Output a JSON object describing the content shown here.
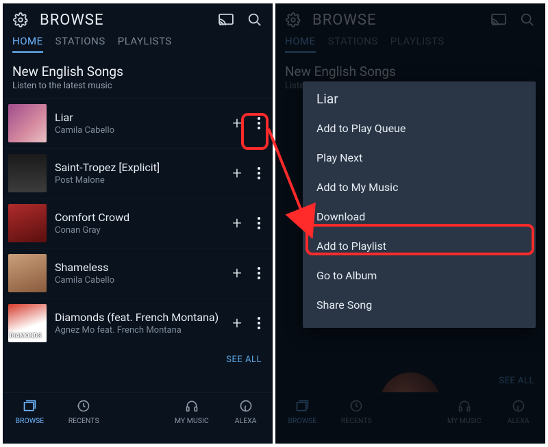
{
  "header": {
    "title": "BROWSE"
  },
  "tabs": [
    "HOME",
    "STATIONS",
    "PLAYLISTS"
  ],
  "active_tab_index": 0,
  "section": {
    "title": "New English Songs",
    "subtitle": "Listen to the latest music"
  },
  "songs": [
    {
      "title": "Liar",
      "artist": "Camila Cabello"
    },
    {
      "title": "Saint-Tropez [Explicit]",
      "artist": "Post Malone"
    },
    {
      "title": "Comfort Crowd",
      "artist": "Conan Gray"
    },
    {
      "title": "Shameless",
      "artist": "Camila Cabello"
    },
    {
      "title": "Diamonds (feat. French Montana)",
      "artist": "Agnez Mo feat. French Montana",
      "art_label": "DIAMONDS"
    }
  ],
  "see_all": "SEE ALL",
  "bottom_nav": {
    "left_items": [
      {
        "label": "BROWSE"
      },
      {
        "label": "RECENTS"
      },
      {
        "label": "MY MUSIC"
      },
      {
        "label": "ALEXA"
      }
    ],
    "active_index": 0
  },
  "menu": {
    "title": "Liar",
    "items": [
      "Add to Play Queue",
      "Play Next",
      "Add to My Music",
      "Download",
      "Add to Playlist",
      "Go to Album",
      "Share Song"
    ],
    "highlight_index": 3
  },
  "annotation": {
    "color": "#ff2a2a"
  }
}
